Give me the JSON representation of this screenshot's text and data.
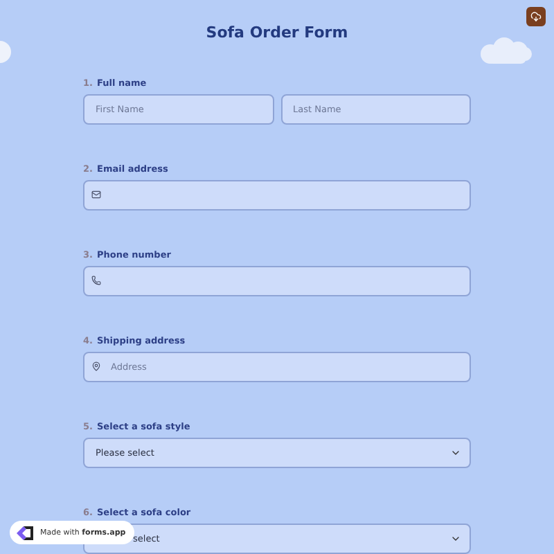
{
  "title": "Sofa Order Form",
  "questions": [
    {
      "number": "1.",
      "label": "Full name",
      "kind": "name",
      "placeholders": [
        "First Name",
        "Last Name"
      ]
    },
    {
      "number": "2.",
      "label": "Email address",
      "kind": "email"
    },
    {
      "number": "3.",
      "label": "Phone number",
      "kind": "phone"
    },
    {
      "number": "4.",
      "label": "Shipping address",
      "kind": "address",
      "placeholder": "Address"
    },
    {
      "number": "5.",
      "label": "Select a sofa style",
      "kind": "select",
      "value": "Please select"
    },
    {
      "number": "6.",
      "label": "Select a sofa color",
      "kind": "select",
      "value": "select",
      "covered": true
    }
  ],
  "badge": "Made with **forms.app**"
}
